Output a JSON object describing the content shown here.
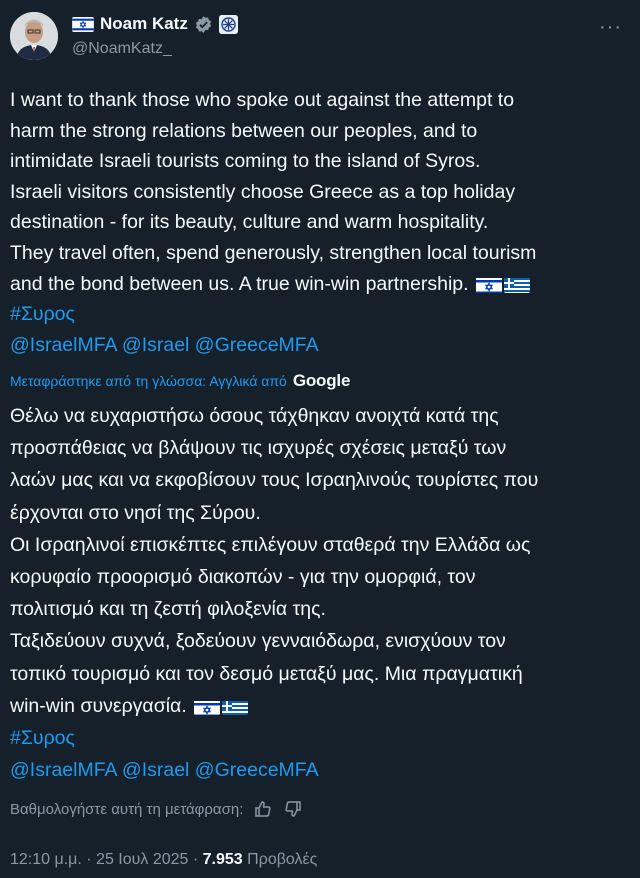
{
  "author": {
    "name": "Noam Katz",
    "handle": "@NoamKatz_"
  },
  "menu_icon": "more-dots-icon",
  "tweet": {
    "lines": [
      "I want to thank those who spoke out against the attempt to",
      "harm the strong relations between our peoples, and to",
      "intimidate Israeli tourists coming to the island of Syros.",
      "Israeli visitors consistently choose Greece as a top holiday",
      "destination - for its beauty, culture and warm hospitality.",
      "They travel often, spend generously, strengthen local tourism",
      "and the bond between us. A true win-win partnership."
    ],
    "hashtag": "#Συρος",
    "mentions": "@IsraelMFA @Israel @GreeceMFA"
  },
  "translation": {
    "notice": "Μεταφράστηκε από τη γλώσσα: Αγγλικά από",
    "provider": "Google",
    "lines": [
      "Θέλω να ευχαριστήσω όσους τάχθηκαν ανοιχτά κατά της",
      "προσπάθειας να βλάψουν τις ισχυρές σχέσεις μεταξύ των",
      "λαών μας και να εκφοβίσουν τους Ισραηλινούς τουρίστες που",
      "έρχονται στο νησί της Σύρου.",
      "Οι Ισραηλινοί επισκέπτες επιλέγουν σταθερά την Ελλάδα ως",
      "κορυφαίο προορισμό διακοπών - για την ομορφιά, τον",
      "πολιτισμό και τη ζεστή φιλοξενία της.",
      "Ταξιδεύουν συχνά, ξοδεύουν γενναιόδωρα, ενισχύουν τον",
      "τοπικό τουρισμό και τον δεσμό μεταξύ μας. Μια πραγματική",
      "win-win συνεργασία."
    ],
    "hashtag": "#Συρος",
    "mentions": "@IsraelMFA @Israel @GreeceMFA",
    "rate_label": "Βαθμολογήστε αυτή τη μετάφραση:"
  },
  "meta": {
    "time": "12:10 μ.μ.",
    "date": "25 Ιουλ 2025",
    "views_count": "7.953",
    "views_label": "Προβολές"
  },
  "colors": {
    "background": "#15202b",
    "text": "#f7f9f9",
    "secondary": "#8b98a5",
    "link": "#1d9bf0"
  }
}
